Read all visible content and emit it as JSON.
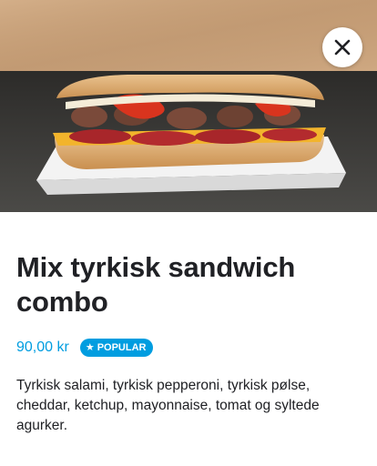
{
  "item": {
    "title": "Mix tyrkisk sandwich combo",
    "price": "90,00 kr",
    "badge": "POPULAR",
    "description": "Tyrkisk salami, tyrkisk pepperoni, tyrkisk pølse, cheddar, ketchup, mayonnaise, tomat og syltede agurker."
  },
  "icons": {
    "close": "close-icon",
    "badge": "star-icon"
  },
  "colors": {
    "accent": "#009de0",
    "text": "#202125"
  }
}
